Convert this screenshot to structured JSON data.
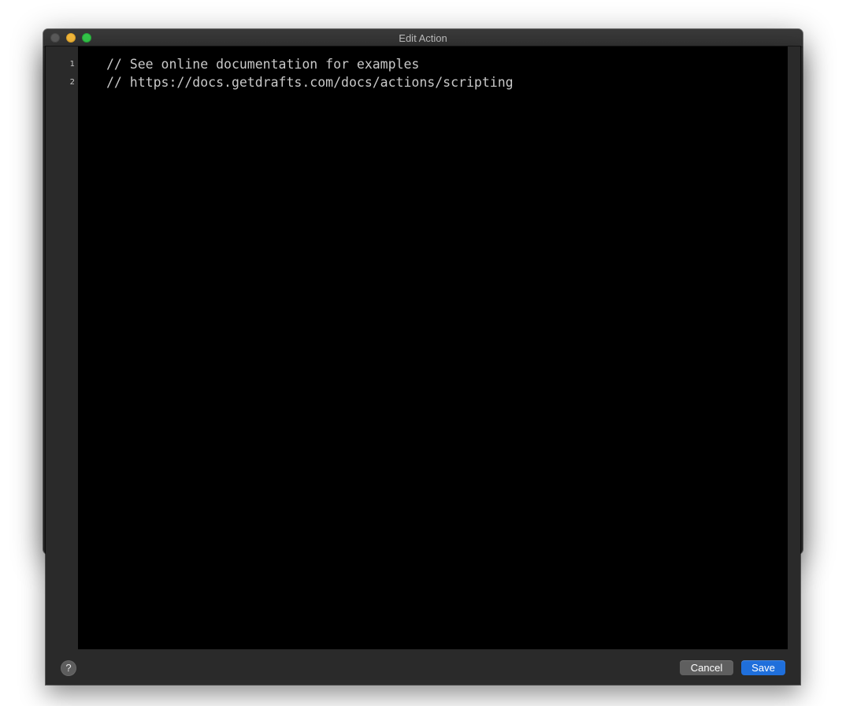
{
  "window": {
    "title": "Edit Action",
    "controls": [
      "close",
      "minimize",
      "zoom"
    ]
  },
  "editor": {
    "lines": [
      {
        "number": "1",
        "text": "// See online documentation for examples"
      },
      {
        "number": "2",
        "text": "// https://docs.getdrafts.com/docs/actions/scripting"
      }
    ]
  },
  "footer": {
    "help_label": "?",
    "cancel_label": "Cancel",
    "save_label": "Save"
  },
  "colors": {
    "editor_background": "#000000",
    "chrome_background": "#2a2a2a",
    "save_button": "#1f6fdb",
    "cancel_button": "#5f5f5f",
    "minimize": "#f5b93b",
    "zoom": "#34c84a"
  },
  "icons": {
    "help": "question-mark-icon"
  }
}
